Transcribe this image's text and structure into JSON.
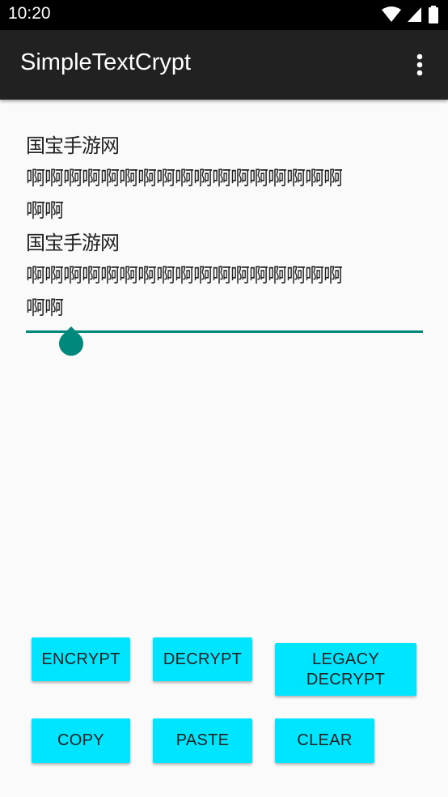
{
  "status_bar": {
    "time": "10:20"
  },
  "app_bar": {
    "title": "SimpleTextCrypt"
  },
  "editor": {
    "text": "国宝手游网\n啊啊啊啊啊啊啊啊啊啊啊啊啊啊啊啊啊\n啊啊\n国宝手游网\n啊啊啊啊啊啊啊啊啊啊啊啊啊啊啊啊啊\n啊啊"
  },
  "buttons": {
    "encrypt": "ENCRYPT",
    "decrypt": "DECRYPT",
    "legacy_decrypt": "LEGACY DECRYPT",
    "copy": "COPY",
    "paste": "PASTE",
    "clear": "CLEAR"
  },
  "colors": {
    "accent": "#00897b",
    "button": "#00e5ff",
    "toolbar": "#212121"
  }
}
